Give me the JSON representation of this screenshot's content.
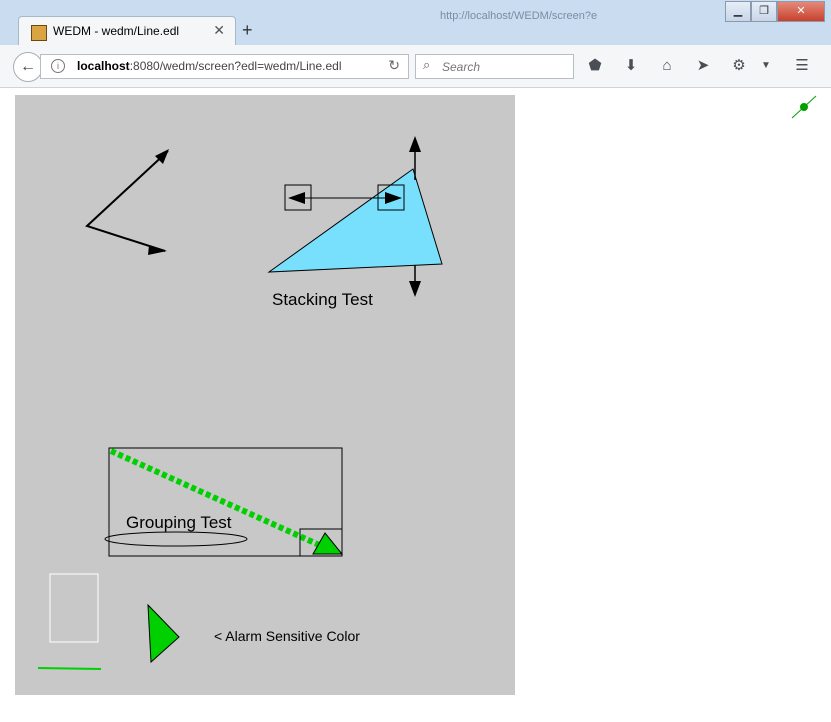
{
  "browser": {
    "tab_title": "WEDM - wedm/Line.edl",
    "tab_close": "✕",
    "new_tab": "+",
    "background_tab_title": "http://localhost/WEDM/screen?e",
    "url_host": "localhost",
    "url_rest": ":8080/wedm/screen?edl=wedm/Line.edl",
    "search_placeholder": "Search",
    "window_buttons": [
      "▁",
      "❐",
      "✕"
    ]
  },
  "screen": {
    "stacking_label": "Stacking Test",
    "grouping_label": "Grouping Test",
    "alarm_label": "< Alarm Sensitive Color"
  },
  "colors": {
    "canvas_bg": "#c8c8c8",
    "triangle_fill": "#78e0fc",
    "alarm_green": "#00d000"
  }
}
